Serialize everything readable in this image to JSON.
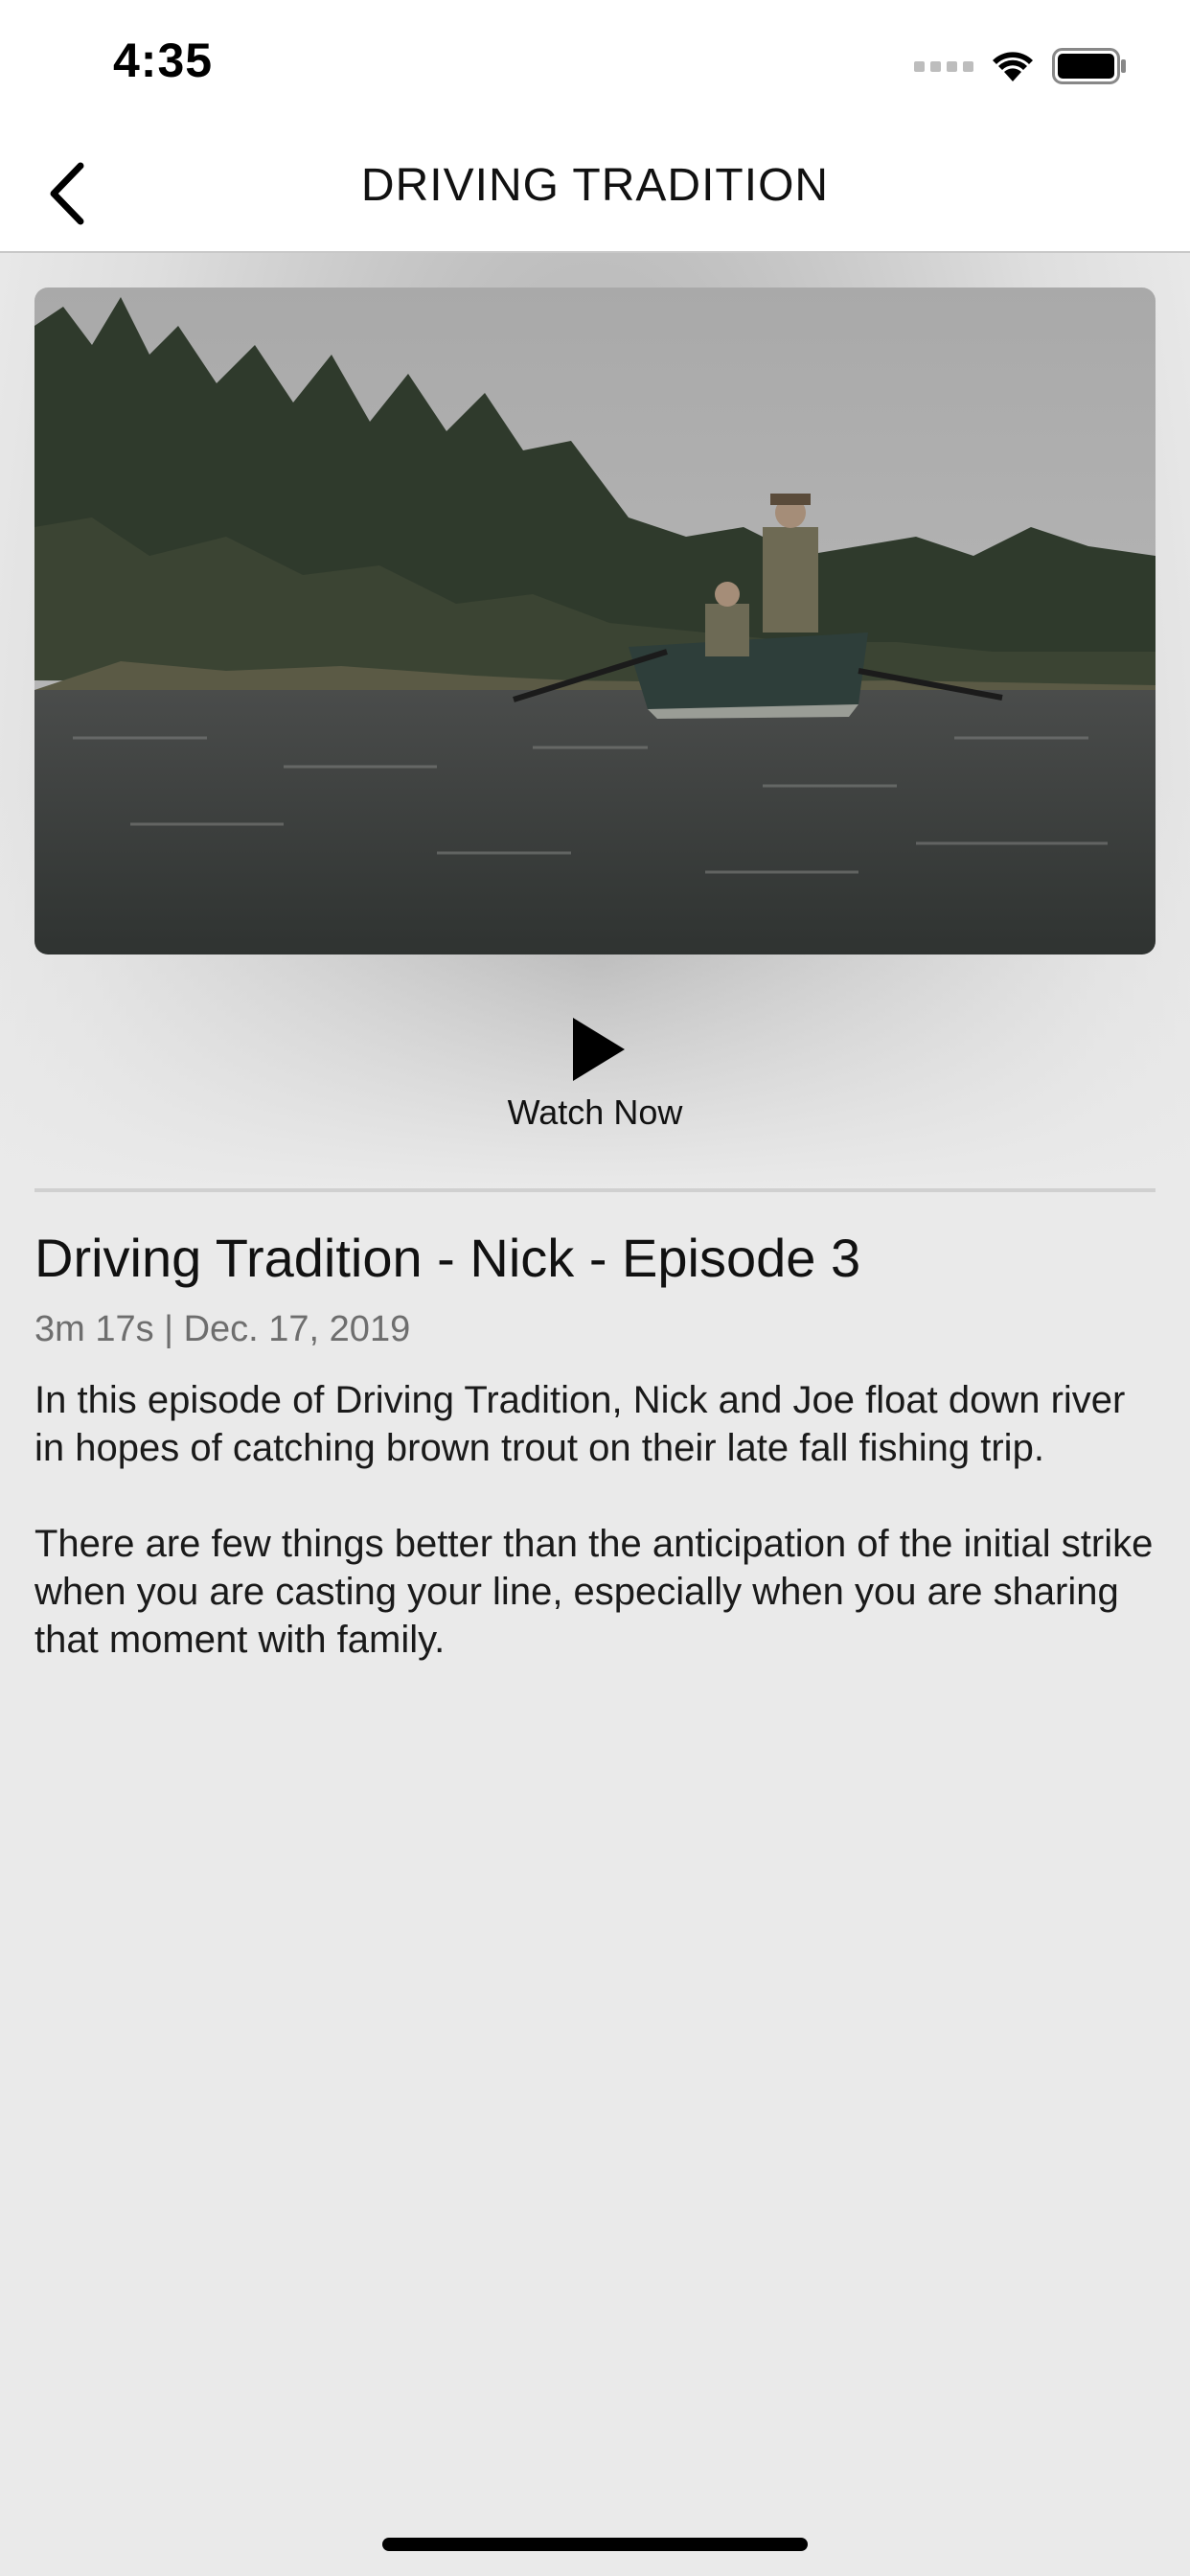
{
  "status_bar": {
    "time": "4:35"
  },
  "nav": {
    "title": "DRIVING TRADITION",
    "back_icon": "chevron-left-icon"
  },
  "video": {
    "thumbnail_alt": "Two men in a drift boat fishing on a river lined with autumn forest",
    "watch_label": "Watch Now",
    "play_icon": "play-icon"
  },
  "episode": {
    "title": "Driving Tradition - Nick - Episode 3",
    "meta": "3m 17s | Dec. 17, 2019",
    "description": [
      "In this episode of Driving Tradition, Nick and Joe float down river in hopes of catching brown trout on their late fall fishing trip.",
      "There are few things better than the anticipation of the initial strike when you are casting your line, especially when you are sharing that moment with family."
    ]
  },
  "colors": {
    "background": "#eaeaea",
    "nav_background": "#ffffff",
    "meta_text": "#6e6e6e",
    "divider": "#d0d0d0"
  }
}
